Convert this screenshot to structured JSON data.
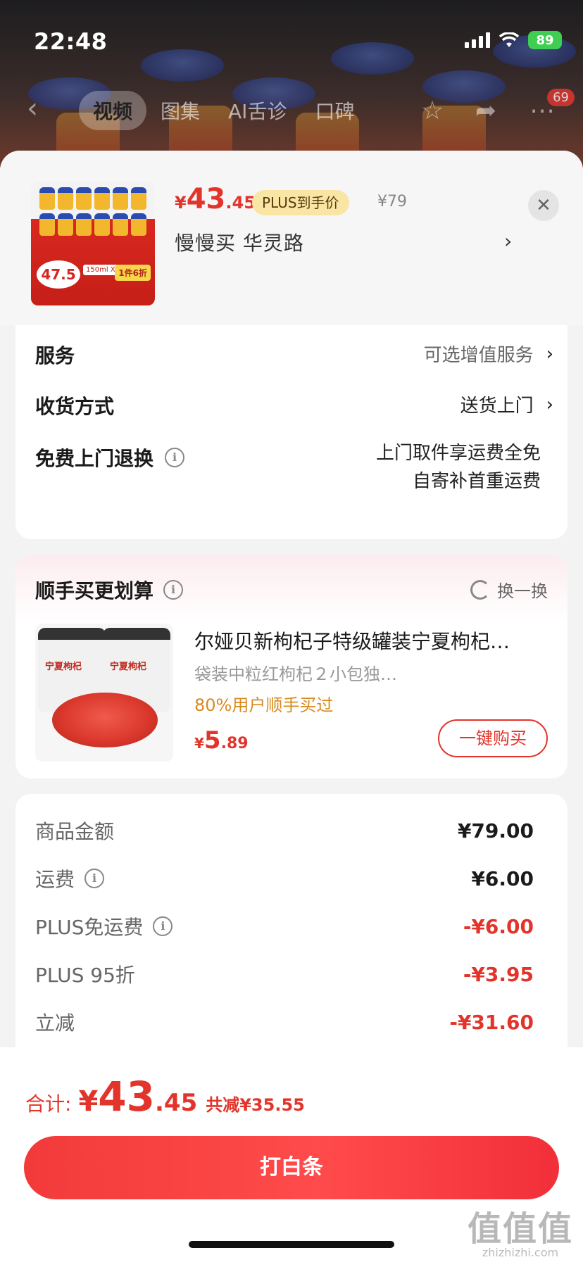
{
  "status_bar": {
    "time": "22:48",
    "battery": "89"
  },
  "nav": {
    "tabs": [
      "视频",
      "图集",
      "AI舌诊",
      "口碑"
    ],
    "active_tab": 0,
    "badge": "69"
  },
  "product": {
    "price_yen": "¥",
    "price_int": "43",
    "price_dec": ".45",
    "plus_tag": "PLUS到手价",
    "original_price": "¥79",
    "seller": "慢慢买  华灵路",
    "thumb": {
      "price": "47.5",
      "spec": "150ml X12",
      "tag": "1件6折"
    }
  },
  "options": {
    "service": {
      "label": "服务",
      "value": "可选增值服务"
    },
    "delivery": {
      "label": "收货方式",
      "value": "送货上门"
    },
    "return": {
      "label": "免费上门退换",
      "line1": "上门取件享运费全免",
      "line2": "自寄补首重运费"
    }
  },
  "bundle": {
    "title": "顺手买更划算",
    "refresh": "换一换",
    "name": "尔娅贝新枸杞子特级罐装宁夏枸杞…",
    "desc": "袋装中粒红枸杞２小包独…",
    "stat": "80%用户顺手买过",
    "price_yen": "¥",
    "price_int": "5",
    "price_dec": ".89",
    "buy": "一键购买",
    "can_label": "宁夏枸杞"
  },
  "summary": {
    "rows": [
      {
        "label": "商品金额",
        "value": "¥79.00",
        "neg": false,
        "info": false
      },
      {
        "label": "运费",
        "value": "¥6.00",
        "neg": false,
        "info": true
      },
      {
        "label": "PLUS免运费",
        "value": "-¥6.00",
        "neg": true,
        "info": true
      },
      {
        "label": "PLUS 95折",
        "value": "-¥3.95",
        "neg": true,
        "info": false
      },
      {
        "label": "立减",
        "value": "-¥31.60",
        "neg": true,
        "info": false
      }
    ]
  },
  "bottom": {
    "total_label": "合计:",
    "total_yen": "¥",
    "total_int": "43",
    "total_dec": ".45",
    "total_save": "共减¥35.55",
    "pay_label": "打白条"
  },
  "watermark": {
    "mark": "值值值",
    "sub": "zhizhizhi.com"
  }
}
